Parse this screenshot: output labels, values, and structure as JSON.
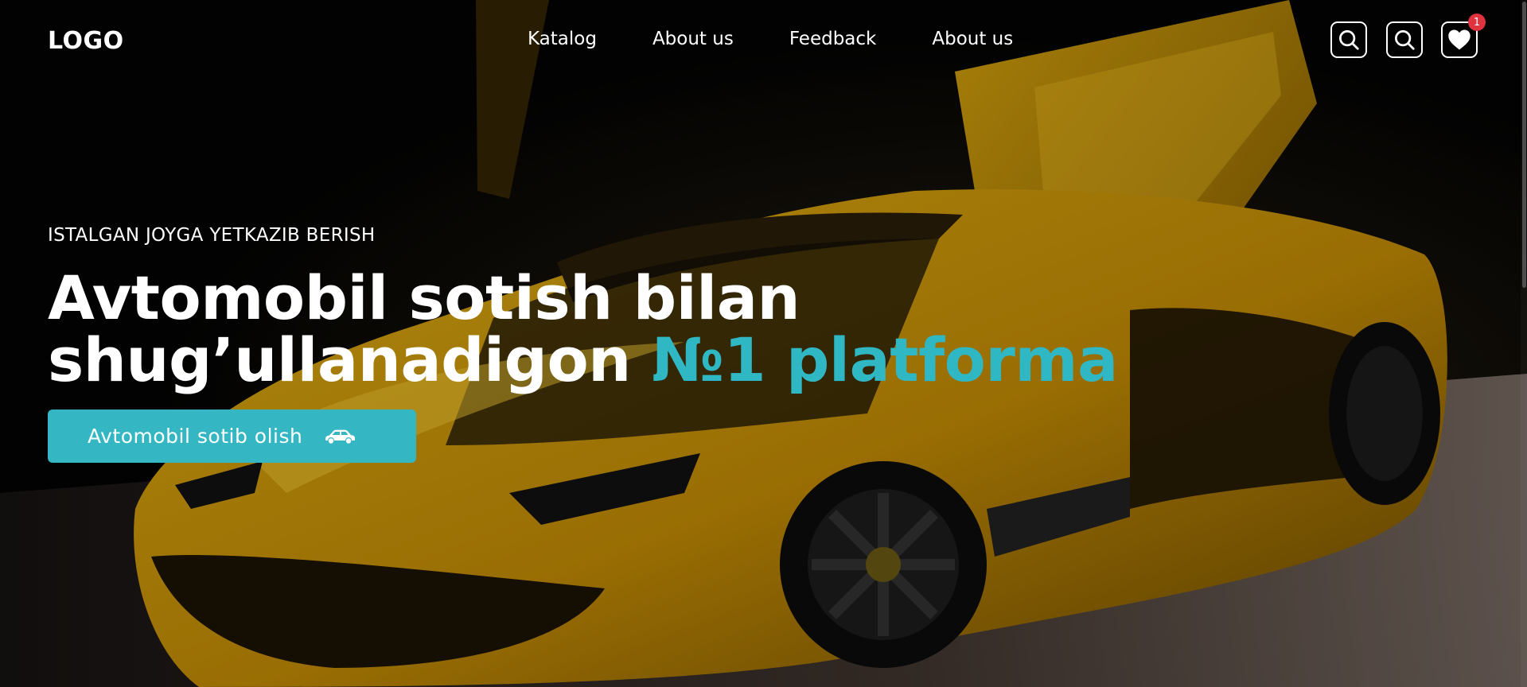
{
  "header": {
    "logo": "LOGO",
    "nav": [
      {
        "label": "Katalog"
      },
      {
        "label": "About us"
      },
      {
        "label": "Feedback"
      },
      {
        "label": "About us"
      }
    ],
    "icons": [
      "search-icon",
      "search-icon",
      "heart-icon"
    ],
    "favorites_count": "1"
  },
  "hero": {
    "eyebrow": "ISTALGAN JOYGA YETKAZIB BERISH",
    "headline_line1": "Avtomobil sotish bilan",
    "headline_line2": "shug’ullanadigon",
    "headline_accent": "№1 platforma",
    "cta_label": "Avtomobil sotib olish"
  },
  "colors": {
    "accent": "#2fb8c3",
    "button": "#34b7c2",
    "badge": "#e0323f",
    "car": "#f2b705"
  }
}
